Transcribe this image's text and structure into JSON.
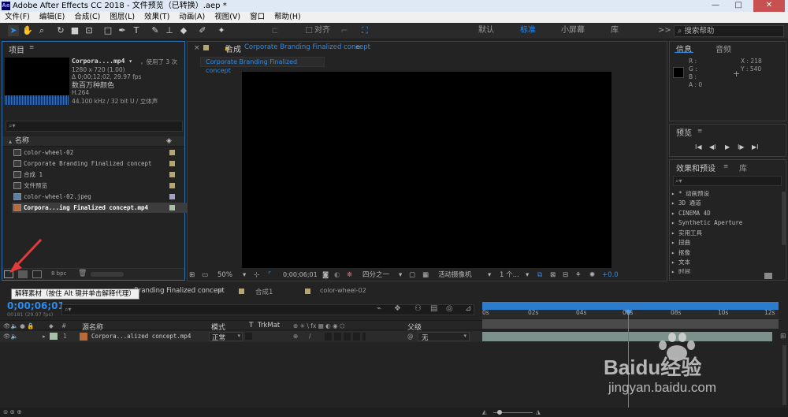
{
  "window": {
    "title": "Adobe After Effects CC 2018 - 文件预览（已转换）.aep *",
    "app_icon": "Ae",
    "buttons": {
      "minimize": "—",
      "maximize": "□",
      "close": "✕"
    }
  },
  "menu": [
    "文件(F)",
    "编辑(E)",
    "合成(C)",
    "图层(L)",
    "效果(T)",
    "动画(A)",
    "视图(V)",
    "窗口",
    "帮助(H)"
  ],
  "toolbar": {
    "snap_label": "对齐",
    "workspaces": [
      "默认",
      "标准",
      "小屏幕",
      "库"
    ],
    "active_workspace": "标准",
    "more": ">>",
    "search_placeholder": "搜索帮助"
  },
  "project": {
    "title": "项目",
    "file_name": "Corpora....mp4 ▾",
    "used": "，使用了 3 次",
    "resolution": "1280 x 720 (1.00)",
    "duration": "Δ 0;00;12;02, 29.97 fps",
    "colors": "数百万种颜色",
    "codec": "H.264",
    "audio": "44.100 kHz / 32 bit U / 立体声",
    "search_placeholder": "",
    "col_name": "名称",
    "items": [
      {
        "name": "color-wheel-02",
        "type": "comp"
      },
      {
        "name": "Corporate Branding  Finalized concept",
        "type": "comp"
      },
      {
        "name": "合成 1",
        "type": "comp"
      },
      {
        "name": "文件预览",
        "type": "comp"
      },
      {
        "name": "color-wheel-02.jpeg",
        "type": "image"
      },
      {
        "name": "Corpora...ing  Finalized concept.mp4",
        "type": "video"
      }
    ],
    "bpc": "8 bpc"
  },
  "composition": {
    "title_prefix": "合成",
    "title": "Corporate Branding  Finalized concept",
    "tab": "Corporate Branding  Finalized concept",
    "zoom": "50%",
    "timecode": "0;00;06;01",
    "resolution": "四分之一",
    "camera": "活动摄像机",
    "views": "1 个...",
    "exposure": "+0.0"
  },
  "info": {
    "title": "信息",
    "audio_tab": "音频",
    "r": "R :",
    "g": "G :",
    "b": "B :",
    "a": "A : 0",
    "x": "X : 218",
    "y": "Y : 540"
  },
  "preview": {
    "title": "预览",
    "controls": [
      "I◀",
      "◀I",
      "▶",
      "I▶",
      "▶I"
    ]
  },
  "effects": {
    "title": "效果和预设",
    "lib_tab": "库",
    "items": [
      "* 动画预设",
      "3D 通道",
      "CINEMA 4D",
      "Synthetic Aperture",
      "实用工具",
      "扭曲",
      "抠像",
      "文本",
      "时间"
    ]
  },
  "tooltip": "解释素材（按住 Alt 键并单击解释代理）",
  "timeline": {
    "tabs": [
      {
        "label": "Corporate Branding  Finalized concept",
        "visible": "Branding  Finalized concept",
        "active": true
      },
      {
        "label": "合成1",
        "active": false
      },
      {
        "label": "color-wheel-02",
        "active": false
      }
    ],
    "timecode": "0;00;06;01",
    "fps_sub": "00181 (29.97 fps)",
    "ruler": [
      "0s",
      "02s",
      "04s",
      "06s",
      "08s",
      "10s",
      "12s"
    ],
    "columns": {
      "source": "源名称",
      "mode": "模式",
      "t": "T",
      "trkmat": "TrkMat",
      "parent": "父级"
    },
    "layers": [
      {
        "index": "1",
        "name": "Corpora...alized concept.mp4",
        "mode": "正常",
        "parent": "无"
      }
    ]
  },
  "watermark": {
    "brand": "Baidu经验",
    "url": "jingyan.baidu.com"
  },
  "colors": {
    "accent": "#2d8ceb",
    "panel_bg": "#232323",
    "comp_bg": "#000000",
    "label": "#b5a571"
  }
}
